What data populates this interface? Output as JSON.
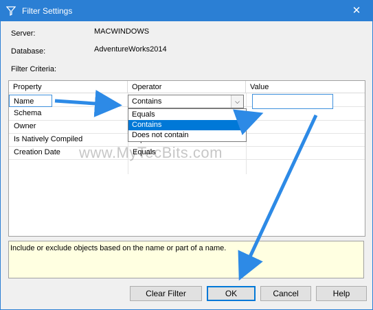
{
  "window": {
    "title": "Filter Settings",
    "close_glyph": "✕",
    "title_icon": "filter-icon",
    "accent_color": "#2b7fd4"
  },
  "info": {
    "server_label": "Server:",
    "server_value": "MACWINDOWS",
    "database_label": "Database:",
    "database_value": "AdventureWorks2014",
    "criteria_label": "Filter Criteria:"
  },
  "grid": {
    "headers": [
      "Property",
      "Operator",
      "Value"
    ],
    "rows": [
      {
        "property": "Name",
        "operator": "Contains",
        "value": ""
      },
      {
        "property": "Schema",
        "operator": "",
        "value": ""
      },
      {
        "property": "Owner",
        "operator": "",
        "value": ""
      },
      {
        "property": "Is Natively Compiled",
        "operator": "Equals",
        "value": ""
      },
      {
        "property": "Creation Date",
        "operator": "Equals",
        "value": ""
      }
    ]
  },
  "dropdown": {
    "options": [
      "Equals",
      "Contains",
      "Does not contain"
    ],
    "selected": "Contains"
  },
  "description": "Include or exclude objects based on the name or part of a name.",
  "buttons": {
    "clear_filter": "Clear Filter",
    "ok": "OK",
    "cancel": "Cancel",
    "help": "Help"
  },
  "watermark": "www.MyTecBits.com",
  "annotation_color": "#2d8ae6"
}
